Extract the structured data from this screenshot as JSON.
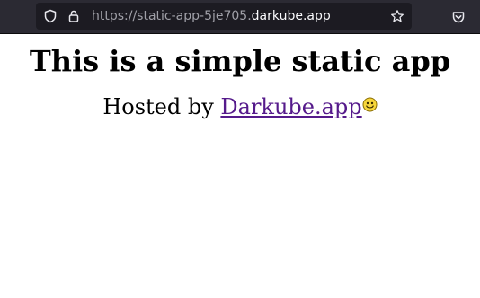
{
  "browser": {
    "url_prefix": "https://static-app-5je705.",
    "url_domain": "darkube.app",
    "toolbar_bg": "#2b2a33",
    "urlbar_bg": "#1c1b22",
    "icons": [
      "shield-icon",
      "lock-icon",
      "star-icon",
      "pocket-icon"
    ]
  },
  "page": {
    "title": "This is a simple static app",
    "hosted_prefix": "Hosted by ",
    "link_text": "Darkube.app",
    "link_color": "#551a8b",
    "emoji": "smiley-face-icon"
  }
}
